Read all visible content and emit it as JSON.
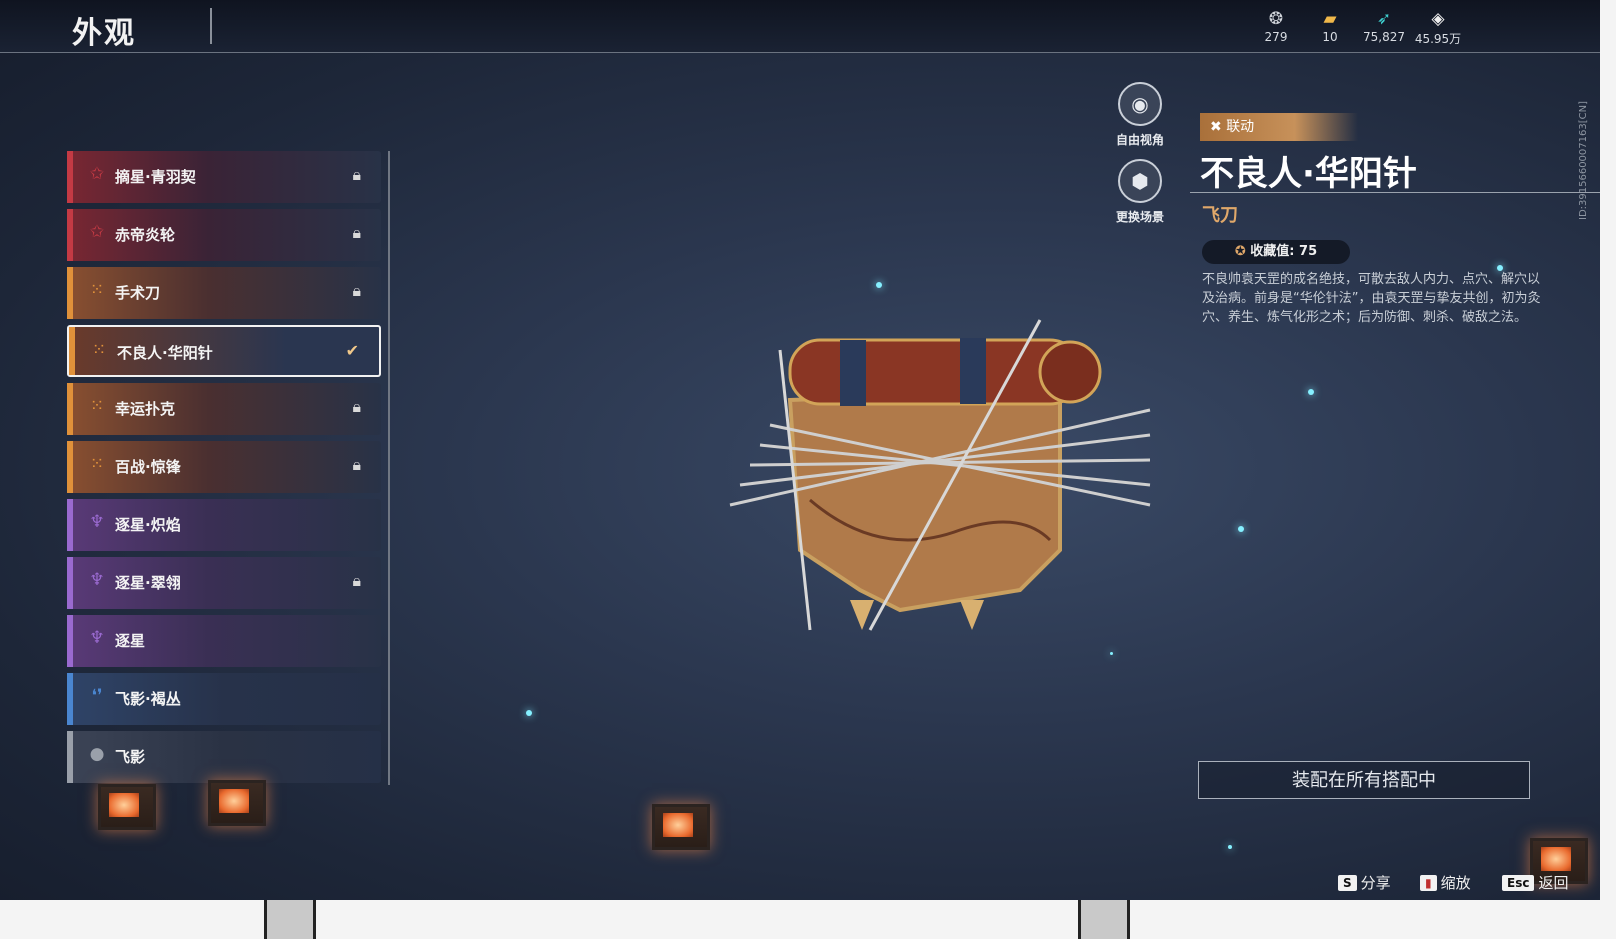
{
  "header": {
    "title": "外观"
  },
  "currencies": [
    {
      "icon": "mask-icon",
      "value": "279"
    },
    {
      "icon": "chest-icon",
      "value": "10"
    },
    {
      "icon": "feather-icon",
      "value": "75,827"
    },
    {
      "icon": "diamond-icon",
      "value": "45.95万"
    }
  ],
  "account_id": "ID:3915660007163[CN]",
  "items": [
    {
      "label": "摘星·青羽契",
      "state": "locked",
      "rarity": "red"
    },
    {
      "label": "赤帝炎轮",
      "state": "locked",
      "rarity": "red"
    },
    {
      "label": "手术刀",
      "state": "locked",
      "rarity": "orange"
    },
    {
      "label": "不良人·华阳针",
      "state": "selected",
      "rarity": "orange"
    },
    {
      "label": "幸运扑克",
      "state": "locked",
      "rarity": "orange"
    },
    {
      "label": "百战·惊锋",
      "state": "locked",
      "rarity": "orange"
    },
    {
      "label": "逐星·炽焰",
      "state": "unlocked",
      "rarity": "purple"
    },
    {
      "label": "逐星·翠翎",
      "state": "locked",
      "rarity": "purple"
    },
    {
      "label": "逐星",
      "state": "unlocked",
      "rarity": "purple"
    },
    {
      "label": "飞影·褐丛",
      "state": "unlocked",
      "rarity": "blue"
    },
    {
      "label": "飞影",
      "state": "unlocked",
      "rarity": "gray"
    }
  ],
  "view_controls": {
    "free_view": "自由视角",
    "change_scene": "更换场景"
  },
  "detail": {
    "tag": "联动",
    "name": "不良人·华阳针",
    "type": "飞刀",
    "collection": "收藏值: 75",
    "description": "不良帅袁天罡的成名绝技，可散去敌人内力、点穴、解穴以及治病。前身是“华伦针法”，由袁天罡与挚友共创，初为灸穴、养生、炼气化形之术；后为防御、刺杀、破敌之法。",
    "equip_button": "装配在所有搭配中"
  },
  "hotkeys": [
    {
      "key": "S",
      "label": "分享"
    },
    {
      "key": "mouse-icon",
      "label": "缩放"
    },
    {
      "key": "Esc",
      "label": "返回"
    }
  ],
  "colors": {
    "red": "#c43a44",
    "orange": "#e0913a",
    "purple": "#9a6ad0",
    "blue": "#4a86d0",
    "gray": "#9aa0aa",
    "accent": "#e0a86a"
  }
}
